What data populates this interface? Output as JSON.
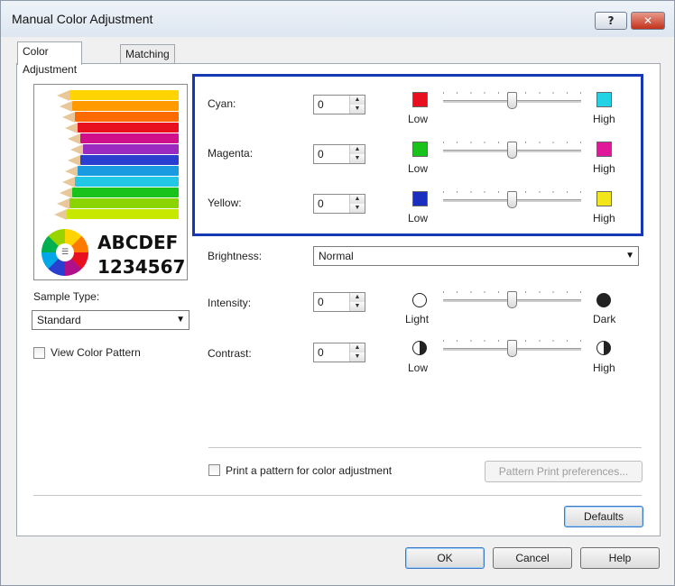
{
  "window": {
    "title": "Manual Color Adjustment",
    "help_glyph": "?",
    "close_glyph": "✕"
  },
  "tabs": [
    {
      "label": "Color Adjustment",
      "active": true
    },
    {
      "label": "Matching",
      "active": false
    }
  ],
  "preview": {
    "line1": "ABCDEF",
    "line2": "1234567",
    "wheel_center": "☰"
  },
  "sample_type": {
    "label": "Sample Type:",
    "value": "Standard"
  },
  "view_color_pattern": {
    "label": "View Color Pattern",
    "checked": false
  },
  "color_balance": [
    {
      "label": "Cyan:",
      "value": "0",
      "low_label": "Low",
      "high_label": "High",
      "low_color": "#e8101e",
      "high_color": "#22d3e6",
      "level": 0.5
    },
    {
      "label": "Magenta:",
      "value": "0",
      "low_label": "Low",
      "high_label": "High",
      "low_color": "#19c31c",
      "high_color": "#e0189a",
      "level": 0.5
    },
    {
      "label": "Yellow:",
      "value": "0",
      "low_label": "Low",
      "high_label": "High",
      "low_color": "#1a2fc0",
      "high_color": "#f2e61a",
      "level": 0.5
    }
  ],
  "brightness": {
    "label": "Brightness:",
    "value": "Normal"
  },
  "intensity": {
    "label": "Intensity:",
    "value": "0",
    "low_label": "Light",
    "high_label": "Dark",
    "level": 0.5
  },
  "contrast": {
    "label": "Contrast:",
    "value": "0",
    "low_label": "Low",
    "high_label": "High",
    "level": 0.5
  },
  "print_pattern": {
    "label": "Print a pattern for color adjustment",
    "checked": false
  },
  "pattern_print_button": "Pattern Print preferences...",
  "defaults_button": "Defaults",
  "footer": {
    "ok": "OK",
    "cancel": "Cancel",
    "help": "Help"
  },
  "colors": {
    "highlight_border": "#1638b4"
  }
}
